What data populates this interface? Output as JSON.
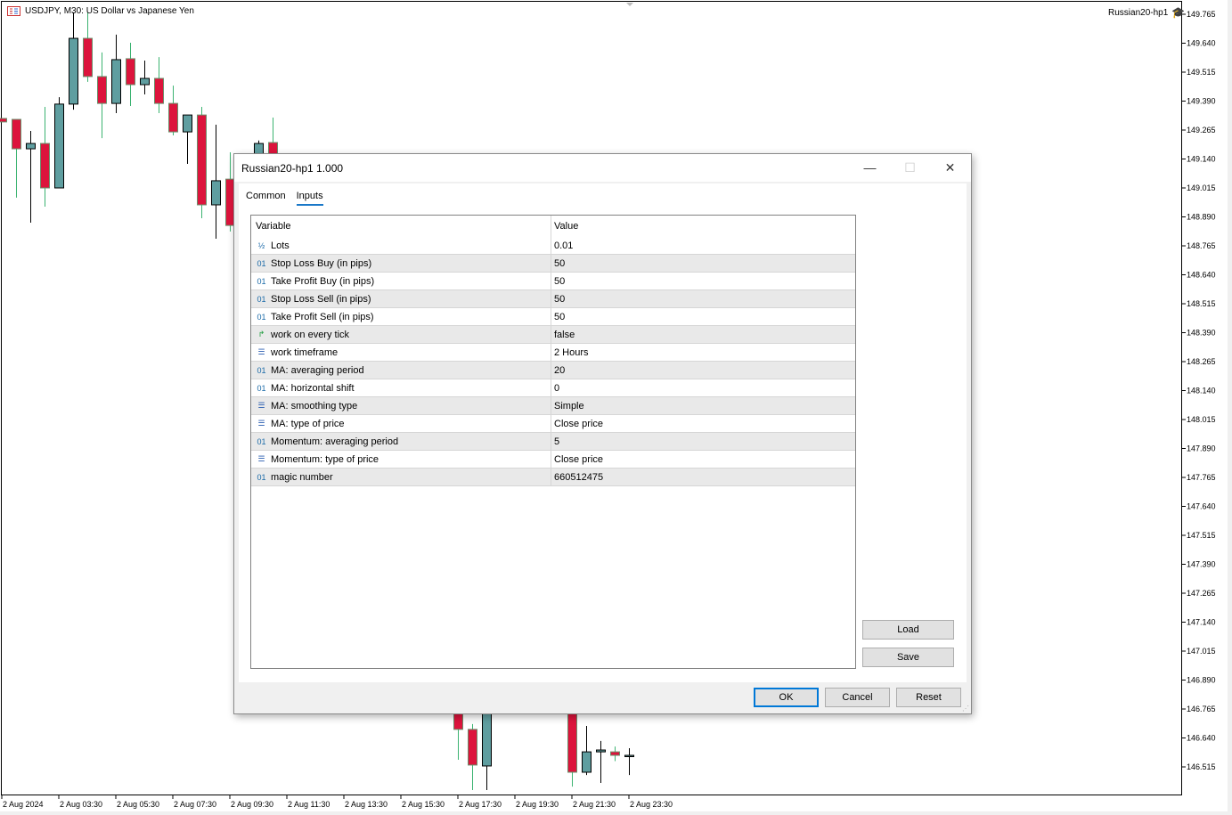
{
  "chart_header": {
    "title": "USDJPY, M30:  US Dollar vs Japanese Yen",
    "ea_name": "Russian20-hp1"
  },
  "chart_data": {
    "type": "candlestick",
    "symbol": "USDJPY",
    "timeframe": "M30",
    "colors": {
      "bull": "#5f9ea0",
      "bear": "#dc143c",
      "bull_wick": "#000000",
      "bear_wick": "#3cb371"
    },
    "ylim": [
      146.42,
      149.79
    ],
    "price_ticks": [
      "149.765",
      "149.640",
      "149.515",
      "149.390",
      "149.265",
      "149.140",
      "149.015",
      "148.890",
      "148.765",
      "148.640",
      "148.515",
      "148.390",
      "148.265",
      "148.140",
      "148.015",
      "147.890",
      "147.765",
      "147.640",
      "147.515",
      "147.390",
      "147.265",
      "147.140",
      "147.015",
      "146.890",
      "146.765",
      "146.640",
      "146.515"
    ],
    "time_ticks": [
      {
        "bar": 0,
        "label": "2 Aug 2024"
      },
      {
        "bar": 4,
        "label": "2 Aug 03:30"
      },
      {
        "bar": 8,
        "label": "2 Aug 05:30"
      },
      {
        "bar": 12,
        "label": "2 Aug 07:30"
      },
      {
        "bar": 16,
        "label": "2 Aug 09:30"
      },
      {
        "bar": 20,
        "label": "2 Aug 11:30"
      },
      {
        "bar": 24,
        "label": "2 Aug 13:30"
      },
      {
        "bar": 28,
        "label": "2 Aug 15:30"
      },
      {
        "bar": 32,
        "label": "2 Aug 17:30"
      },
      {
        "bar": 36,
        "label": "2 Aug 19:30"
      },
      {
        "bar": 40,
        "label": "2 Aug 21:30"
      },
      {
        "bar": 44,
        "label": "2 Aug 23:30"
      }
    ],
    "candles": [
      {
        "bar": 0,
        "o": 149.315,
        "h": 149.315,
        "l": 149.3,
        "c": 149.3
      },
      {
        "bar": 1,
        "o": 149.311,
        "h": 149.311,
        "l": 148.973,
        "c": 149.184
      },
      {
        "bar": 2,
        "o": 149.184,
        "h": 149.261,
        "l": 148.865,
        "c": 149.207
      },
      {
        "bar": 3,
        "o": 149.207,
        "h": 149.365,
        "l": 148.934,
        "c": 149.015
      },
      {
        "bar": 4,
        "o": 149.015,
        "h": 149.407,
        "l": 149.015,
        "c": 149.377
      },
      {
        "bar": 5,
        "o": 149.377,
        "h": 149.773,
        "l": 149.353,
        "c": 149.661
      },
      {
        "bar": 6,
        "o": 149.661,
        "h": 149.773,
        "l": 149.473,
        "c": 149.496
      },
      {
        "bar": 7,
        "o": 149.496,
        "h": 149.6,
        "l": 149.23,
        "c": 149.38
      },
      {
        "bar": 8,
        "o": 149.38,
        "h": 149.677,
        "l": 149.338,
        "c": 149.569
      },
      {
        "bar": 9,
        "o": 149.573,
        "h": 149.642,
        "l": 149.369,
        "c": 149.461
      },
      {
        "bar": 10,
        "o": 149.461,
        "h": 149.565,
        "l": 149.419,
        "c": 149.488
      },
      {
        "bar": 11,
        "o": 149.488,
        "h": 149.58,
        "l": 149.338,
        "c": 149.38
      },
      {
        "bar": 12,
        "o": 149.38,
        "h": 149.457,
        "l": 149.242,
        "c": 149.257
      },
      {
        "bar": 13,
        "o": 149.257,
        "h": 149.288,
        "l": 149.119,
        "c": 149.33
      },
      {
        "bar": 14,
        "o": 149.33,
        "h": 149.365,
        "l": 148.884,
        "c": 148.942
      },
      {
        "bar": 15,
        "o": 148.942,
        "h": 149.288,
        "l": 148.796,
        "c": 149.046
      },
      {
        "bar": 16,
        "o": 149.053,
        "h": 149.169,
        "l": 148.827,
        "c": 148.853
      },
      {
        "bar": 18,
        "o": 149.15,
        "h": 149.22,
        "l": 149.1,
        "c": 149.207
      },
      {
        "bar": 19,
        "o": 149.211,
        "h": 149.319,
        "l": 149.1,
        "c": 149.15
      },
      {
        "bar": 32,
        "o": 146.8,
        "h": 146.85,
        "l": 146.546,
        "c": 146.677
      },
      {
        "bar": 33,
        "o": 146.677,
        "h": 146.7,
        "l": 146.415,
        "c": 146.523
      },
      {
        "bar": 34,
        "o": 146.519,
        "h": 146.9,
        "l": 146.415,
        "c": 146.85
      },
      {
        "bar": 40,
        "o": 146.85,
        "h": 146.9,
        "l": 146.43,
        "c": 146.492
      },
      {
        "bar": 41,
        "o": 146.492,
        "h": 146.692,
        "l": 146.48,
        "c": 146.58
      },
      {
        "bar": 42,
        "o": 146.58,
        "h": 146.627,
        "l": 146.446,
        "c": 146.588
      },
      {
        "bar": 43,
        "o": 146.58,
        "h": 146.603,
        "l": 146.54,
        "c": 146.565
      },
      {
        "bar": 44,
        "o": 146.565,
        "h": 146.596,
        "l": 146.48,
        "c": 146.565
      }
    ]
  },
  "dialog": {
    "title": "Russian20-hp1 1.000",
    "tabs": [
      {
        "label": "Common"
      },
      {
        "label": "Inputs",
        "active": true
      }
    ],
    "columns": [
      "Variable",
      "Value"
    ],
    "rows": [
      {
        "icon": "½",
        "type": "double",
        "name": "Lots",
        "value": "0.01"
      },
      {
        "icon": "01",
        "type": "int",
        "name": "Stop Loss Buy (in pips)",
        "value": "50"
      },
      {
        "icon": "01",
        "type": "int",
        "name": "Take Profit Buy (in pips)",
        "value": "50"
      },
      {
        "icon": "01",
        "type": "int",
        "name": "Stop Loss Sell (in pips)",
        "value": "50"
      },
      {
        "icon": "01",
        "type": "int",
        "name": "Take Profit Sell (in pips)",
        "value": "50"
      },
      {
        "icon": "↱",
        "type": "bool",
        "name": "work on every tick",
        "value": "false"
      },
      {
        "icon": "☰",
        "type": "enum",
        "name": "work timeframe",
        "value": "2 Hours"
      },
      {
        "icon": "01",
        "type": "int",
        "name": "MA: averaging period",
        "value": "20"
      },
      {
        "icon": "01",
        "type": "int",
        "name": "MA: horizontal shift",
        "value": "0"
      },
      {
        "icon": "☰",
        "type": "enum",
        "name": "MA: smoothing type",
        "value": "Simple"
      },
      {
        "icon": "☰",
        "type": "enum",
        "name": "MA: type of price",
        "value": "Close price"
      },
      {
        "icon": "01",
        "type": "int",
        "name": "Momentum: averaging period",
        "value": "5"
      },
      {
        "icon": "☰",
        "type": "enum",
        "name": "Momentum: type of price",
        "value": "Close price"
      },
      {
        "icon": "01",
        "type": "int",
        "name": "magic number",
        "value": "660512475"
      }
    ],
    "buttons": {
      "load": "Load",
      "save": "Save",
      "ok": "OK",
      "cancel": "Cancel",
      "reset": "Reset"
    }
  }
}
